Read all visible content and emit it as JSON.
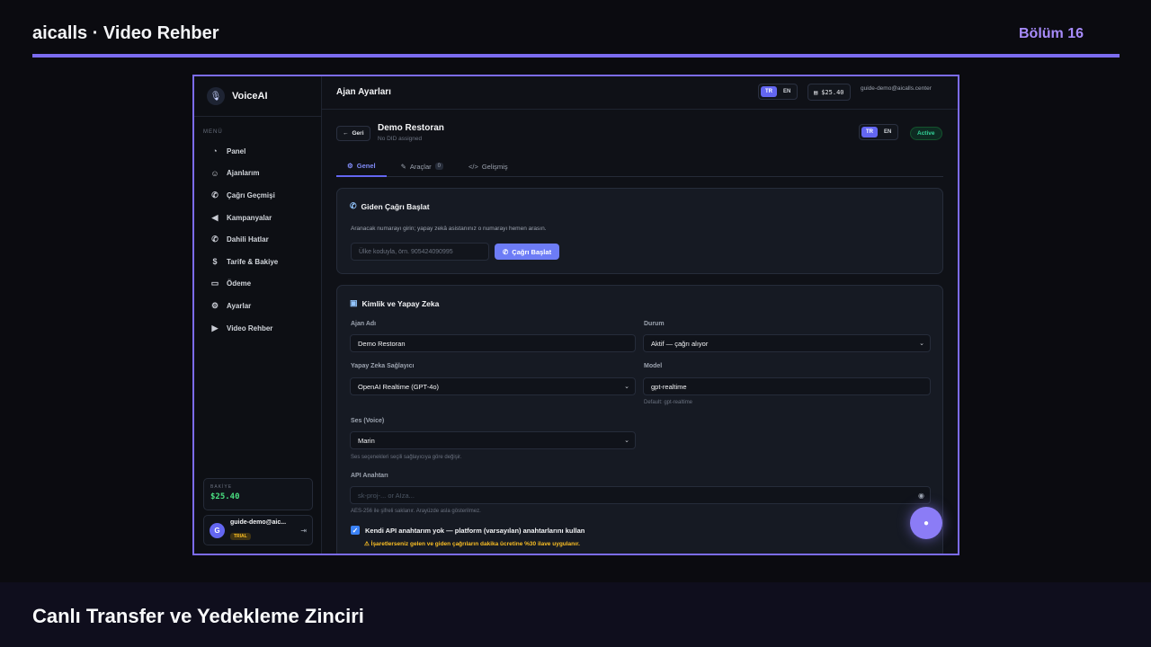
{
  "header": {
    "title": "aicalls · Video Rehber",
    "episode": "Bölüm 16"
  },
  "sidebar": {
    "brand": "VoiceAI",
    "menu_label": "MENÜ",
    "items": [
      {
        "label": "Panel",
        "icon": "gauge-icon"
      },
      {
        "label": "Ajanlarım",
        "icon": "robot-icon"
      },
      {
        "label": "Çağrı Geçmişi",
        "icon": "phone-icon"
      },
      {
        "label": "Kampanyalar",
        "icon": "megaphone-icon"
      },
      {
        "label": "Dahili Hatlar",
        "icon": "phone-volume-icon"
      },
      {
        "label": "Tarife & Bakiye",
        "icon": "dollar-icon"
      },
      {
        "label": "Ödeme",
        "icon": "credit-card-icon"
      },
      {
        "label": "Ayarlar",
        "icon": "gear-icon"
      },
      {
        "label": "Video Rehber",
        "icon": "play-circle-icon"
      }
    ],
    "balance_label": "BAKİYE",
    "balance_value": "$25.40",
    "user_avatar": "G",
    "user_email": "guide-demo@aic...",
    "user_plan": "TRIAL"
  },
  "topbar": {
    "title": "Ajan Ayarları",
    "lang_tr": "TR",
    "lang_en": "EN",
    "wallet": "$25.40",
    "email": "guide-demo@aicalls.center"
  },
  "agent": {
    "back_label": "Geri",
    "name": "Demo Restoran",
    "did": "No DID assigned",
    "lang_tr": "TR",
    "lang_en": "EN",
    "status": "Active"
  },
  "tabs": [
    {
      "label": "Genel"
    },
    {
      "label": "Araçlar",
      "count": "0"
    },
    {
      "label": "Gelişmiş"
    }
  ],
  "outbound": {
    "title": "Giden Çağrı Başlat",
    "description": "Aranacak numarayı girin; yapay zekâ asistanınız o numarayı hemen arasın.",
    "placeholder": "Ülke koduyla, örn. 905424090995",
    "button": "Çağrı Başlat"
  },
  "identity": {
    "title": "Kimlik ve Yapay Zeka",
    "agent_name_label": "Ajan Adı",
    "agent_name_value": "Demo Restoran",
    "status_label": "Durum",
    "status_value": "Aktif — çağrı alıyor",
    "provider_label": "Yapay Zeka Sağlayıcı",
    "provider_value": "OpenAI Realtime (GPT-4o)",
    "model_label": "Model",
    "model_value": "gpt-realtime",
    "model_hint": "Default: gpt-realtime",
    "voice_label": "Ses (Voice)",
    "voice_value": "Marin",
    "voice_hint": "Ses seçenekleri seçili sağlayıcıya göre değişir.",
    "api_label": "API Anahtarı",
    "api_placeholder": "sk-proj-... or AIza...",
    "api_hint": "AES-256 ile şifreli saklanır. Arayüzde asla gösterilmez.",
    "checkbox_label": "Kendi API anahtarım yok — platform (varsayılan) anahtarlarını kullan",
    "warning": "⚠ İşaretlerseniz gelen ve giden çağrıların dakika ücretine %30 ilave uygulanır."
  },
  "footer": {
    "title": "Canlı Transfer ve Yedekleme Zinciri"
  }
}
